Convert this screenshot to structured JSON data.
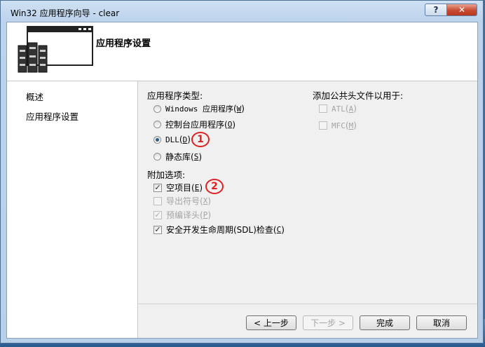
{
  "window": {
    "title": "Win32 应用程序向导 - clear",
    "help_label": "?",
    "close_label": "✕"
  },
  "header": {
    "title": "应用程序设置",
    "graphic": "application-wizard-icon"
  },
  "nav": {
    "items": [
      {
        "label": "概述"
      },
      {
        "label": "应用程序设置"
      }
    ]
  },
  "app_type": {
    "label": "应用程序类型:",
    "options": [
      {
        "label": "Windows 应用程序",
        "hotkey": "W",
        "selected": false
      },
      {
        "label": "控制台应用程序",
        "hotkey": "O",
        "selected": false
      },
      {
        "label": "DLL",
        "hotkey": "D",
        "selected": true
      },
      {
        "label": "静态库",
        "hotkey": "S",
        "selected": false
      }
    ]
  },
  "common_headers": {
    "label": "添加公共头文件以用于:",
    "options": [
      {
        "label": "ATL",
        "hotkey": "A",
        "checked": false,
        "enabled": false
      },
      {
        "label": "MFC",
        "hotkey": "M",
        "checked": false,
        "enabled": false
      }
    ]
  },
  "additional": {
    "label": "附加选项:",
    "options": [
      {
        "label": "空项目",
        "hotkey": "E",
        "checked": true,
        "enabled": true
      },
      {
        "label": "导出符号",
        "hotkey": "X",
        "checked": false,
        "enabled": false
      },
      {
        "label": "预编译头",
        "hotkey": "P",
        "checked": true,
        "enabled": false
      },
      {
        "label": "安全开发生命周期(SDL)检查",
        "hotkey": "C",
        "checked": true,
        "enabled": true
      }
    ]
  },
  "annotations": [
    {
      "label": "1"
    },
    {
      "label": "2"
    }
  ],
  "buttons": {
    "prev": "< 上一步",
    "next": "下一步 >",
    "finish": "完成",
    "cancel": "取消"
  },
  "colors": {
    "annotation": "#e02020",
    "window_frame": "#b7cfe9",
    "close_button": "#c94b31"
  }
}
